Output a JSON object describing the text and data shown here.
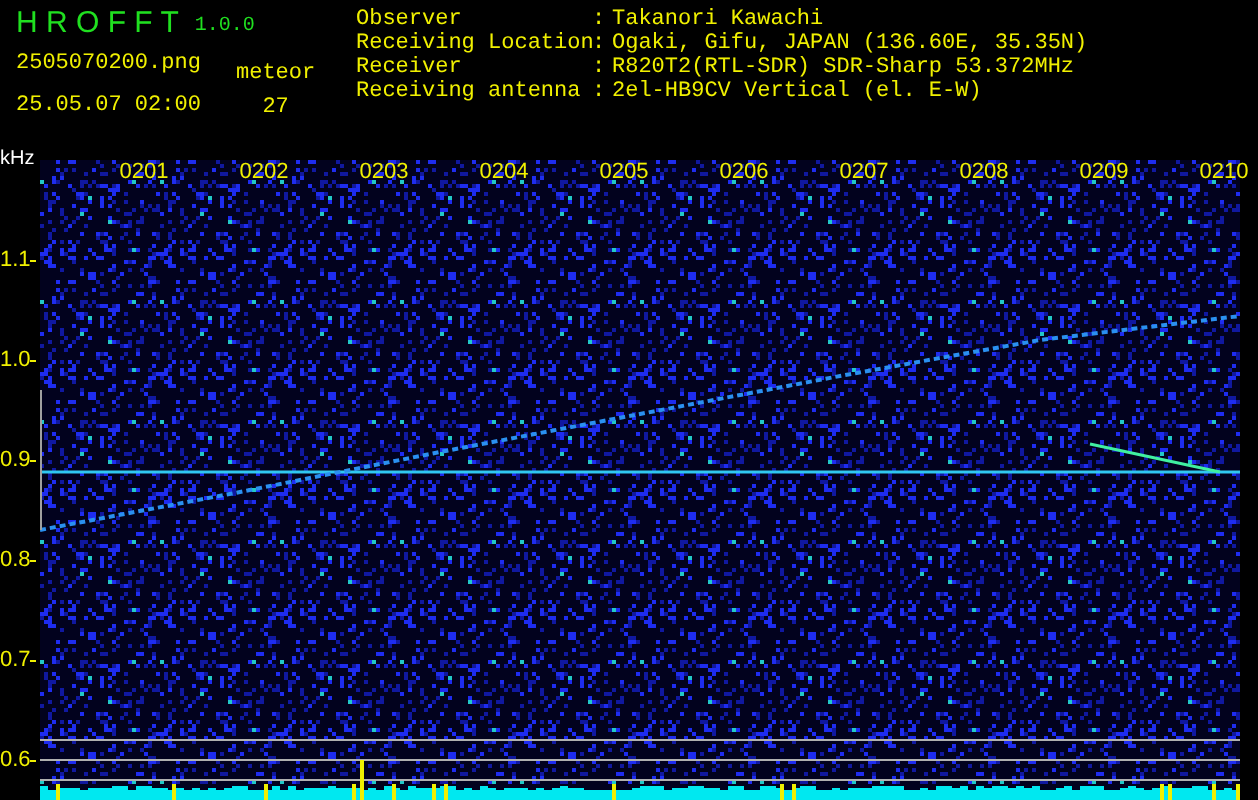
{
  "header": {
    "app_name": "H R O F F T",
    "version": "1.0.0",
    "filename": "2505070200.png",
    "datetime": "25.05.07 02:00",
    "count_label": "meteor",
    "count": "27"
  },
  "info": [
    {
      "label": "Observer",
      "separator": ":",
      "value": "Takanori Kawachi"
    },
    {
      "label": "Receiving Location",
      "separator": ":",
      "value": "Ogaki, Gifu, JAPAN (136.60E, 35.35N)"
    },
    {
      "label": "Receiver",
      "separator": ":",
      "value": "R820T2(RTL-SDR) SDR-Sharp 53.372MHz"
    },
    {
      "label": "Receiving antenna",
      "separator": ":",
      "value": "2el-HB9CV Vertical (el. E-W)"
    }
  ],
  "axis": {
    "unit": "kHz",
    "y_labels": [
      "1.1",
      "1.0",
      "0.9",
      "0.8",
      "0.7",
      "0.6"
    ],
    "time_labels": [
      "0201",
      "0202",
      "0203",
      "0204",
      "0205",
      "0206",
      "0207",
      "0208",
      "0209",
      "0210"
    ]
  }
}
